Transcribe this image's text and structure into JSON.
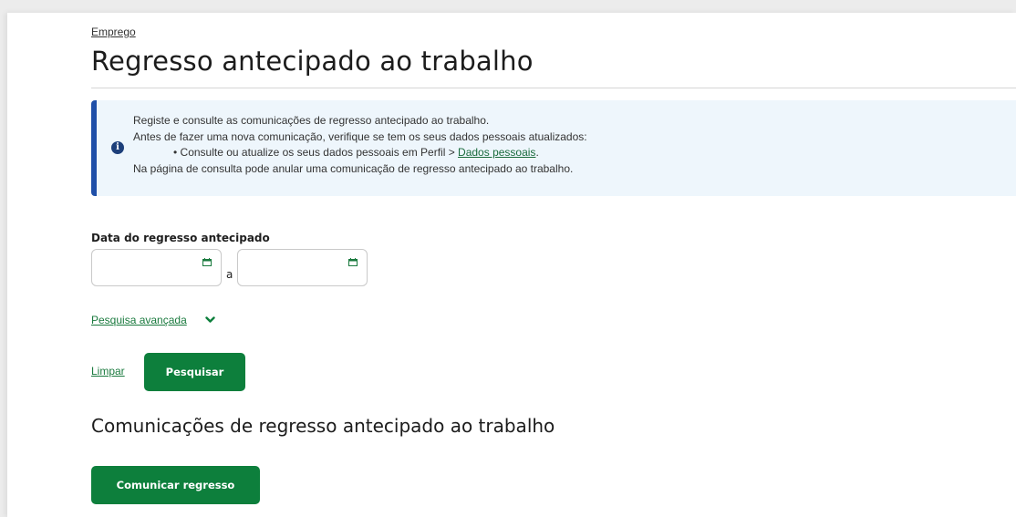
{
  "breadcrumb": "Emprego",
  "page_title": "Regresso antecipado ao trabalho",
  "info": {
    "line1": "Registe e consulte as comunicações de regresso antecipado ao trabalho.",
    "line2": "Antes de fazer uma nova comunicação, verifique se tem os seus dados pessoais atualizados:",
    "bullet_prefix": "• Consulte ou atualize os seus dados pessoais em Perfil > ",
    "bullet_link": "Dados pessoais",
    "bullet_suffix": ".",
    "line4": "Na página de consulta pode anular uma comunicação de regresso antecipado ao trabalho.",
    "icon": "info-icon",
    "accent_color": "#1f4fa8",
    "background_color": "#eef6fc"
  },
  "filter": {
    "date_label": "Data do regresso antecipado",
    "date_from_value": "",
    "date_to_value": "",
    "range_separator": "a",
    "calendar_icon": "calendar-icon",
    "advanced_search_label": "Pesquisa avançada",
    "advanced_search_icon": "chevron-down-icon",
    "clear_label": "Limpar",
    "search_label": "Pesquisar"
  },
  "results": {
    "section_title": "Comunicações de regresso antecipado ao trabalho",
    "communicate_label": "Comunicar regresso"
  },
  "colors": {
    "primary_button": "#0d7f3c",
    "link": "#1a7a3e"
  }
}
